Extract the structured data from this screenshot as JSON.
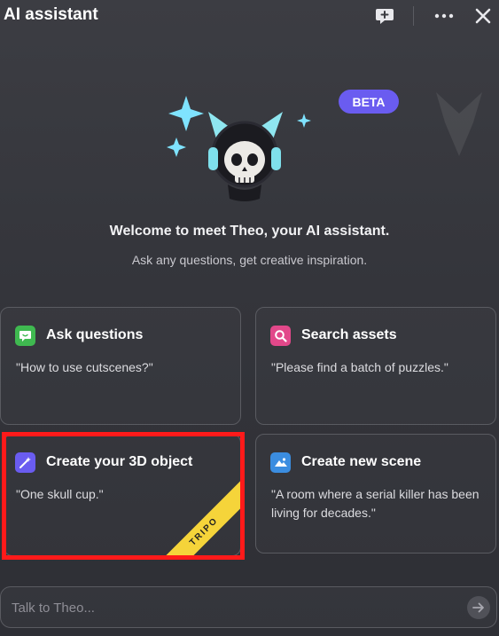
{
  "header": {
    "title": "AI assistant",
    "icons": [
      "new-chat-icon",
      "more-icon",
      "close-icon"
    ]
  },
  "badge": {
    "label": "BETA"
  },
  "welcome": {
    "title": "Welcome to meet Theo, your AI assistant.",
    "subtitle": "Ask any questions, get creative inspiration."
  },
  "cards": [
    {
      "icon": "chat-bubble-icon",
      "icon_color": "#3fb950",
      "title": "Ask questions",
      "desc": "\"How to use cutscenes?\""
    },
    {
      "icon": "search-icon",
      "icon_color": "#e2488a",
      "title": "Search assets",
      "desc": "\"Please find a batch of puzzles.\""
    },
    {
      "icon": "magic-wand-icon",
      "icon_color": "#6a5cf0",
      "title": "Create your 3D object",
      "desc": "\"One skull cup.\"",
      "ribbon": "TRIPO"
    },
    {
      "icon": "landscape-icon",
      "icon_color": "#3b8de0",
      "title": "Create new scene",
      "desc": "\"A room where a serial killer has been living for decades.\""
    }
  ],
  "input": {
    "placeholder": "Talk to Theo..."
  },
  "colors": {
    "accent": "#6a5cf0",
    "highlight": "#ff1a1a",
    "ribbon": "#f5d43a"
  }
}
